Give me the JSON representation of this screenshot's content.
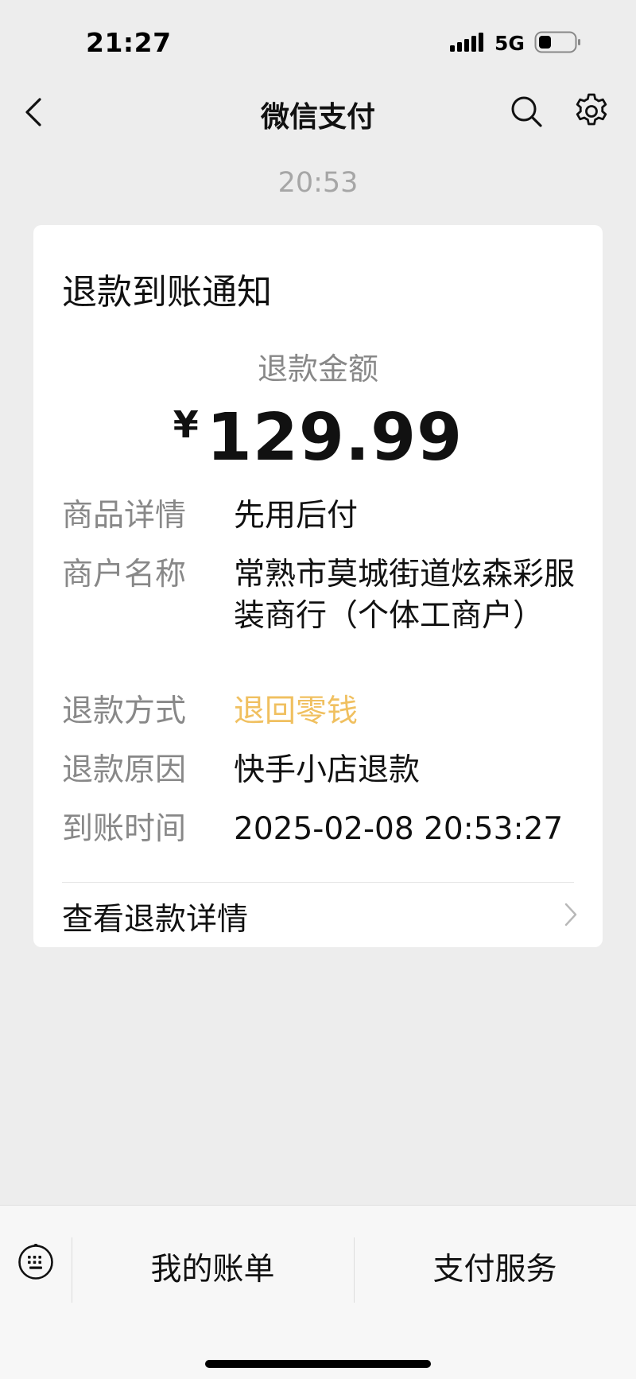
{
  "status_bar": {
    "time": "21:27",
    "network": "5G",
    "icons": [
      "signal-icon",
      "battery-icon"
    ]
  },
  "nav": {
    "title": "微信支付",
    "icons": [
      "chevron-left-icon",
      "search-icon",
      "gear-icon"
    ]
  },
  "message_time": "20:53",
  "card": {
    "title": "退款到账通知",
    "amount_label": "退款金额",
    "currency": "¥",
    "amount": "129.99",
    "details": [
      {
        "label": "商品详情",
        "value": "先用后付"
      },
      {
        "label": "商户名称",
        "value": "常熟市莫城街道炫森彩服装商行（个体工商户）"
      },
      {
        "label": "退款方式",
        "value": "退回零钱"
      },
      {
        "label": "退款原因",
        "value": "快手小店退款"
      },
      {
        "label": "到账时间",
        "value": "2025-02-08 20:53:27"
      }
    ],
    "view_detail_label": "查看退款详情",
    "highlight_color": "#f0c060"
  },
  "bottom_bar": {
    "icons": [
      "keyboard-icon"
    ],
    "menus": [
      "我的账单",
      "支付服务"
    ]
  }
}
